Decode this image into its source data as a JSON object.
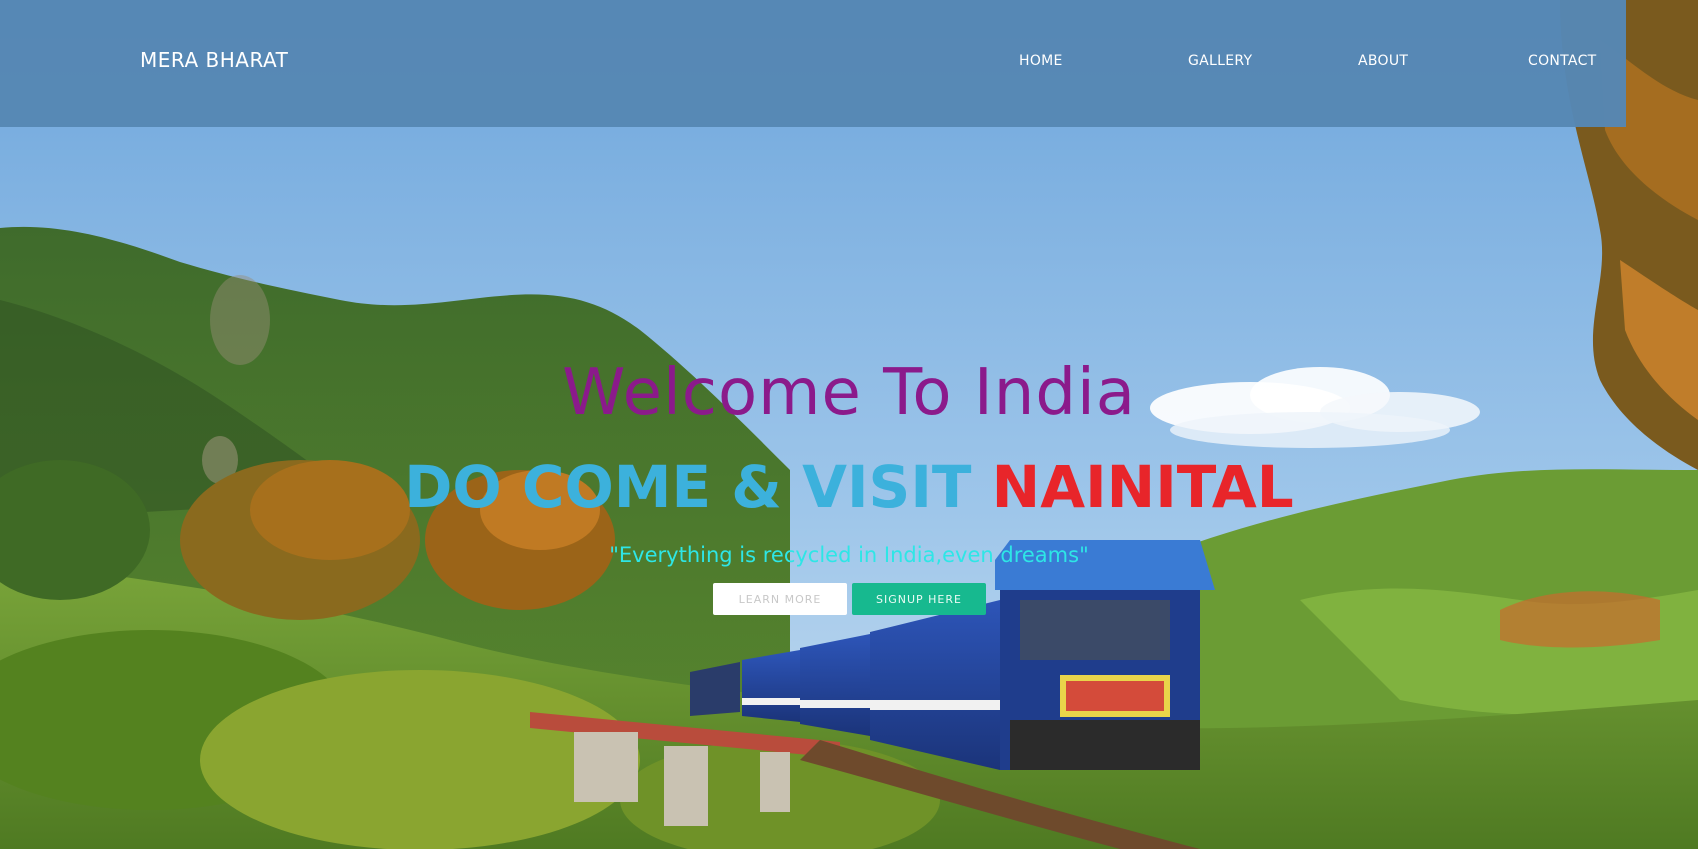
{
  "header": {
    "brand": "MERA BHARAT",
    "nav": [
      {
        "label": "HOME"
      },
      {
        "label": "GALLERY"
      },
      {
        "label": "ABOUT"
      },
      {
        "label": "CONTACT"
      }
    ]
  },
  "hero": {
    "title": "Welcome To India",
    "tagline_part1": "DO COME & VISIT ",
    "tagline_part2": "NAINITAL",
    "quote": "\"Everything is recycled in India,even dreams\"",
    "learn_more": "LEARN MORE",
    "signup": "SIGNUP HERE"
  },
  "colors": {
    "navbar": "#5687b4",
    "title": "#8b1a8b",
    "tagline_part1": "#3cb1dc",
    "tagline_part2": "#e8252a",
    "quote": "#2ee6e6",
    "learn_more_bg": "#ffffff",
    "learn_more_text": "#c8c8c8",
    "signup_bg": "#17b98f",
    "signup_text": "#eafaf4"
  },
  "background": {
    "scene": "mountain-train-landscape"
  }
}
